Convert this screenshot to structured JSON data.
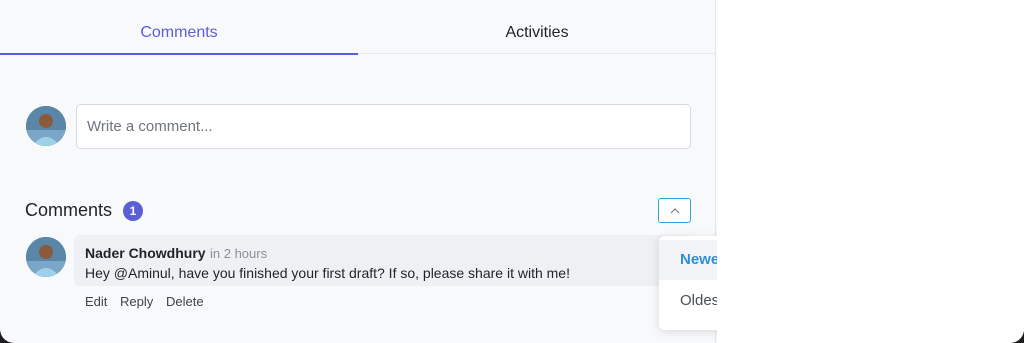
{
  "tabs": [
    {
      "label": "Comments",
      "active": true
    },
    {
      "label": "Activities",
      "active": false
    }
  ],
  "composer": {
    "placeholder": "Write a comment..."
  },
  "comments_section": {
    "title": "Comments",
    "count": "1"
  },
  "sort": {
    "icon": "chevron-up-icon",
    "options": [
      "Newest",
      "Oldest"
    ],
    "selected": "Newest"
  },
  "comments": [
    {
      "author": "Nader Chowdhury",
      "time": "in 2 hours",
      "text": "Hey @Aminul, have you finished your first draft? If so, please share it with me!",
      "actions": [
        "Edit",
        "Reply",
        "Delete"
      ]
    }
  ],
  "colors": {
    "accent": "#5b5fd6",
    "sort_border": "#2fa3d8",
    "selected_option": "#2f8fd6"
  }
}
